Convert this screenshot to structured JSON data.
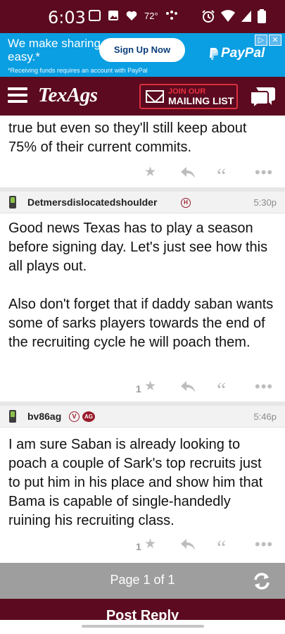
{
  "status_bar": {
    "time": "6:03",
    "temperature": "72°",
    "icons_left": [
      "screen-record-icon",
      "gallery-icon",
      "heart-icon",
      "temperature-icon",
      "dots-icon"
    ],
    "icons_right": [
      "alarm-icon",
      "wifi-icon",
      "signal-icon",
      "battery-icon"
    ]
  },
  "ad": {
    "text": "We make sharing easy.*",
    "button_label": "Sign Up Now",
    "brand": "PayPal",
    "fine_print": "*Receiving funds requires an account with PayPal"
  },
  "header": {
    "logo": "TexAgs",
    "mailing_join": "JOIN OUR",
    "mailing_list": "MAILING LIST",
    "colors": {
      "brand": "#5b0a1f",
      "accent": "#e8303d"
    }
  },
  "thread": {
    "partial_post": {
      "body": "true but even so they'll still keep about 75% of their current commits."
    },
    "posts": [
      {
        "username": "Detmersdislocatedshoulder",
        "badges": [
          "H"
        ],
        "time": "5:30p",
        "body_p1": "Good news Texas has to play a season before signing day. Let's just see how this all plays out.",
        "body_p2": "Also don't forget that if daddy saban wants some of sarks players towards the end of the recruiting cycle he will poach them.",
        "star_count": "1"
      },
      {
        "username": "bv86ag",
        "badges": [
          "V",
          "AG"
        ],
        "time": "5:46p",
        "body_p1": "I am sure Saban is already looking to poach a couple of Sark's top recruits just to put him in his place and show him that Bama is capable of single-handedly ruining his recruiting class.",
        "star_count": "1"
      }
    ]
  },
  "pager": {
    "label": "Page 1 of 1"
  },
  "footer": {
    "post_reply": "Post Reply"
  }
}
